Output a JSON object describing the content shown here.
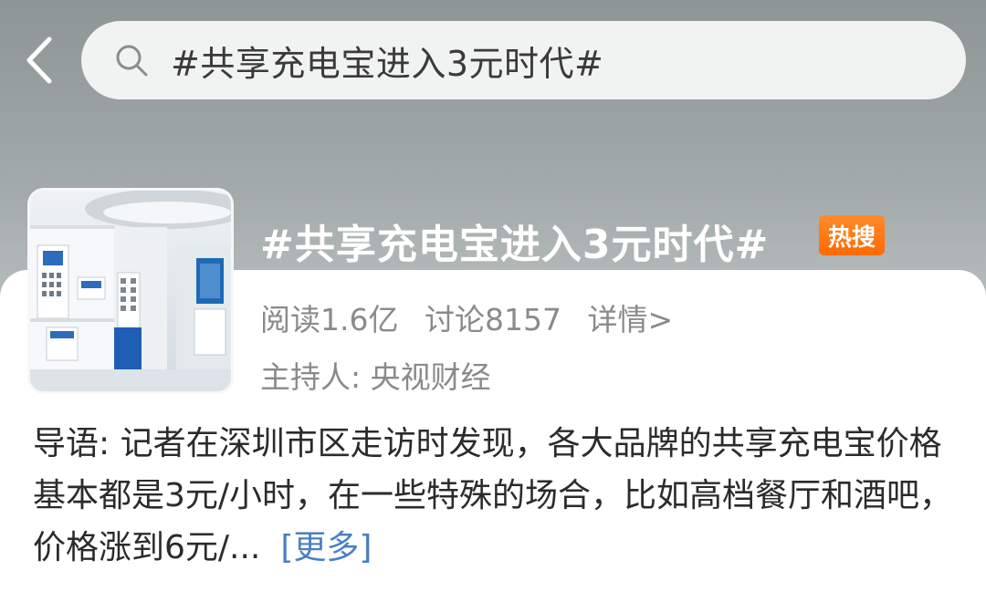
{
  "search": {
    "query": "#共享充电宝进入3元时代#"
  },
  "topic": {
    "title": "#共享充电宝进入3元时代#",
    "badge": "热搜",
    "reads": "阅读1.6亿",
    "discussions": "讨论8157",
    "details_link": "详情>",
    "host": "主持人: 央视财经"
  },
  "intro": {
    "text": "导语: 记者在深圳市区走访时发现，各大品牌的共享充电宝价格基本都是3元/小时，在一些特殊的场合，比如高档餐厅和酒吧，价格涨到6元/...",
    "more_label": "[更多]"
  },
  "icons": {
    "back": "chevron-left-icon",
    "search": "search-icon"
  },
  "colors": {
    "badge": "#ff6a00",
    "link": "#4a7fc1",
    "muted": "#8a8a8a"
  }
}
